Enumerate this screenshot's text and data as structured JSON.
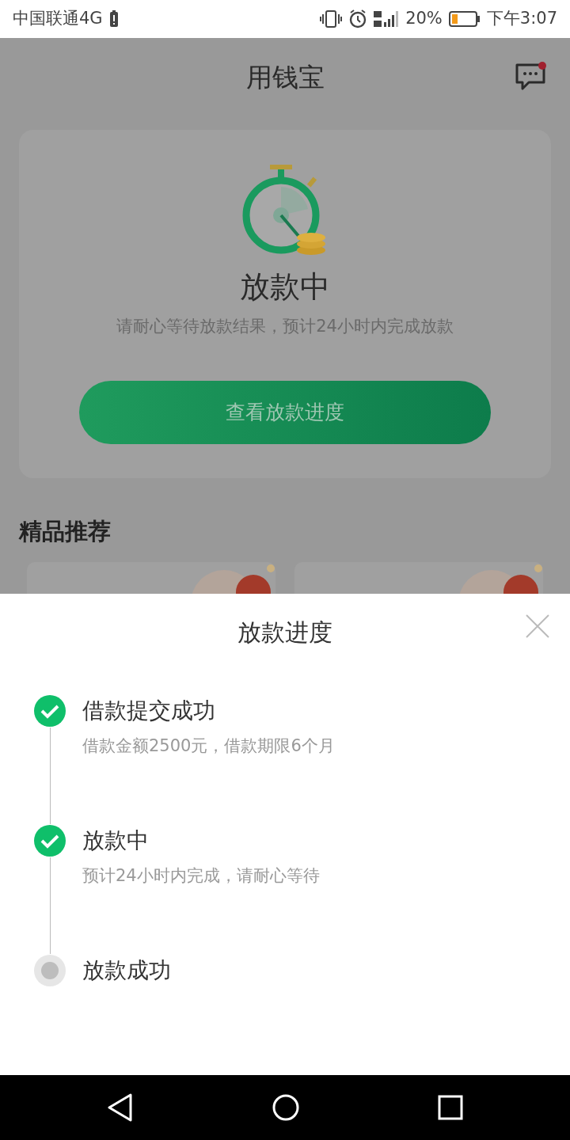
{
  "status_bar": {
    "carrier": "中国联通4G",
    "battery": "20%",
    "time": "下午3:07"
  },
  "header": {
    "title": "用钱宝",
    "messages_unread": true
  },
  "status_card": {
    "title": "放款中",
    "subtitle": "请耐心等待放款结果，预计24小时内完成放款",
    "button": "查看放款进度"
  },
  "recommend": {
    "heading": "精品推荐"
  },
  "sheet": {
    "title": "放款进度",
    "steps": [
      {
        "title": "借款提交成功",
        "detail": "借款金额2500元，借款期限6个月",
        "done": true
      },
      {
        "title": "放款中",
        "detail": "预计24小时内完成，请耐心等待",
        "done": true
      },
      {
        "title": "放款成功",
        "done": false
      }
    ]
  }
}
